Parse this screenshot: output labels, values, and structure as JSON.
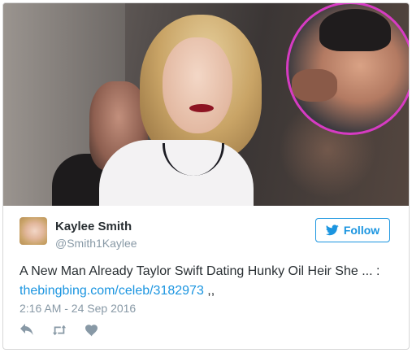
{
  "tweet": {
    "author_name": "Kaylee Smith",
    "author_handle": "@Smith1Kaylee",
    "follow_label": "Follow",
    "text_line1": "A New Man Already Taylor Swift Dating Hunky Oil Heir She ... :",
    "link_text": "thebingbing.com/celeb/3182973",
    "text_suffix": " ,,",
    "timestamp": "2:16 AM - 24 Sep 2016"
  },
  "icons": {
    "follow": "twitter-bird-icon",
    "reply": "reply-icon",
    "retweet": "retweet-icon",
    "like": "heart-icon"
  },
  "colors": {
    "accent": "#1b95e0",
    "text": "#292f33",
    "muted": "#8899a6",
    "inset_ring": "#d63bc2"
  }
}
